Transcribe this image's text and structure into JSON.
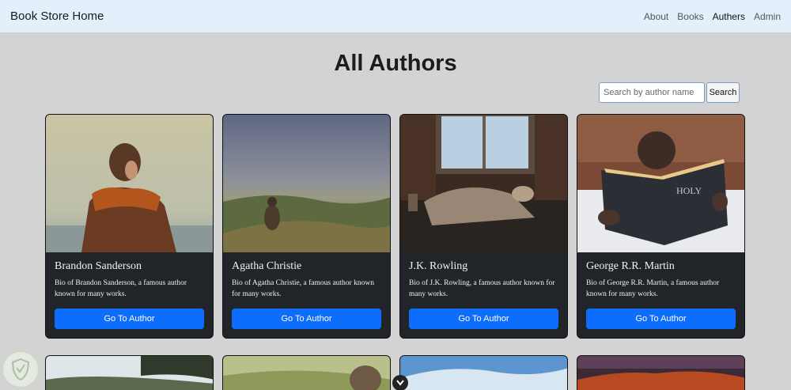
{
  "navbar": {
    "brand": "Book Store Home",
    "links": [
      "About",
      "Books",
      "Authers",
      "Admin"
    ]
  },
  "page": {
    "title": "All Authors"
  },
  "search": {
    "placeholder": "Search by author name",
    "button_label": "Search"
  },
  "authors": [
    {
      "name": "Brandon Sanderson",
      "bio": "Bio of Brandon Sanderson, a famous author known for many works.",
      "button": "Go To Author"
    },
    {
      "name": "Agatha Christie",
      "bio": "Bio of Agatha Christie, a famous author known for many works.",
      "button": "Go To Author"
    },
    {
      "name": "J.K. Rowling",
      "bio": "Bio of J.K. Rowling, a famous author known for many works.",
      "button": "Go To Author"
    },
    {
      "name": "George R.R. Martin",
      "bio": "Bio of George R.R. Martin, a famous author known for many works.",
      "button": "Go To Author"
    }
  ],
  "icons": {
    "scroll": "chevron-down-icon",
    "badge": "shield-icon"
  },
  "colors": {
    "navbar": "#e3f0fb",
    "background": "#d3d3d3",
    "card": "#212529",
    "primary": "#0d6efd"
  }
}
